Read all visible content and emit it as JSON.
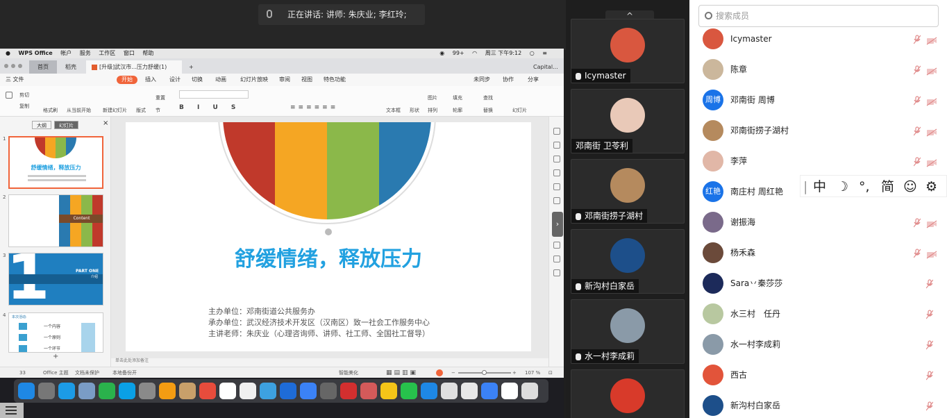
{
  "speaking": {
    "text": "正在讲话: 讲师: 朱庆业; 李红玲;"
  },
  "mac_menu": {
    "app": "WPS Office",
    "items": [
      "帐户",
      "服务",
      "工作区",
      "窗口",
      "帮助"
    ],
    "battery": "99+",
    "clock": "周三 下午9:12"
  },
  "tabs": [
    {
      "label": "首页"
    },
    {
      "label": "稻壳"
    },
    {
      "label": "[升级]武汉市...压力舒缓(1)"
    }
  ],
  "user_tag": "Capital...",
  "menu": {
    "file": "三 文件",
    "items": [
      "开始",
      "插入",
      "设计",
      "切换",
      "动画",
      "幻灯片放映",
      "审阅",
      "视图",
      "特色功能"
    ],
    "sync": "未同步",
    "collab": "协作",
    "share": "分享"
  },
  "ribbon": {
    "cut": "剪切",
    "copy": "复制",
    "paste": "粘贴",
    "format_painter": "格式刷",
    "play": "从当前开始",
    "new_slide": "新建幻灯片",
    "layout": "版式",
    "reset": "重置",
    "section": "节",
    "textbox": "文本框",
    "shapes": "形状",
    "image": "图片",
    "fill": "填充",
    "find": "查找",
    "arrange": "排列",
    "outline": "轮廓",
    "replace": "替换",
    "beautify": "演示工具",
    "slide_tool": "幻灯片"
  },
  "panel": {
    "tab_outline": "大纲",
    "tab_slides": "幻灯片",
    "close": "×",
    "add": "+"
  },
  "thumbs": [
    {
      "num": "1",
      "title": "舒缓情绪，释放压力"
    },
    {
      "num": "2",
      "label": "Content"
    },
    {
      "num": "3",
      "big": "1",
      "label": "PART ONE",
      "sub": "介绍"
    },
    {
      "num": "4",
      "header": "本次活动:",
      "rows": [
        "一个内容",
        "一个原则",
        "一个环节"
      ]
    }
  ],
  "slide": {
    "colors": [
      "#c0392b",
      "#f5a623",
      "#8bb84a",
      "#2a7ab0"
    ],
    "title": "舒缓情绪，释放压力",
    "lines": [
      "主办单位：邓南街道公共服务办",
      "承办单位：武汉经济技术开发区（汉南区）致一社会工作服务中心",
      "主讲老师：朱庆业（心理咨询师、讲师、社工师、全国社工督导）"
    ]
  },
  "notes_hint": "单击此处添加备注",
  "status": {
    "slide_of": "33",
    "theme": "Office 主题",
    "doc_protect": "文档未保护",
    "backup": "本地备份开",
    "beautify": "智能美化",
    "zoom": "107 %",
    "minus": "−",
    "plus": "+"
  },
  "dock_colors": [
    "#1e88e5",
    "#777",
    "#1c9be6",
    "#7a9cc6",
    "#2ab24c",
    "#0aa0e5",
    "#8a8a8a",
    "#f39c12",
    "#c8a06a",
    "#e74c3c",
    "#ffffff",
    "#f0f0f0",
    "#3da1e0",
    "#1e6cd8",
    "#3b82f6",
    "#666",
    "#d32f2f",
    "#d45a5a",
    "#f5c518",
    "#27c24c",
    "#1e88e5",
    "#e0e0e0",
    "#e8e8e8",
    "#3b82f6",
    "#ffffff",
    "#dddddd"
  ],
  "video_tiles": [
    {
      "name": "Icymaster",
      "color": "#d9573f",
      "muted": true
    },
    {
      "name": "邓南街 卫苓利",
      "color": "#e9c9b8",
      "muted": false
    },
    {
      "name": "邓南街捞子湖村",
      "color": "#b58a5e",
      "muted": true
    },
    {
      "name": "新沟村白家岳",
      "color": "#1d4f8a",
      "muted": true
    },
    {
      "name": "水一村李成莉",
      "color": "#8a9aa8",
      "muted": true
    },
    {
      "name": "",
      "color": "#d83a2a",
      "muted": false
    }
  ],
  "search": {
    "placeholder": "搜索成员"
  },
  "members": [
    {
      "name": "Icymaster",
      "color": "#d9573f",
      "initials": "",
      "cam": true
    },
    {
      "name": "陈章",
      "color": "#cbb79c",
      "initials": "",
      "cam": true
    },
    {
      "name": "邓南街 周博",
      "color": "#1a73e8",
      "initials": "周博",
      "cam": true
    },
    {
      "name": "邓南街捞子湖村",
      "color": "#b58a5e",
      "initials": "",
      "cam": true
    },
    {
      "name": "李萍",
      "color": "#e1b7a7",
      "initials": "",
      "cam": true
    },
    {
      "name": "南庄村 周红艳",
      "color": "#1a73e8",
      "initials": "红艳",
      "cam": false
    },
    {
      "name": "谢振海",
      "color": "#7a6a8a",
      "initials": "",
      "cam": true
    },
    {
      "name": "杨禾森",
      "color": "#6b4a3a",
      "initials": "",
      "cam": true
    },
    {
      "name": "Sara丷秦莎莎",
      "color": "#1c2a5a",
      "initials": "",
      "cam": false
    },
    {
      "name": "水三村　任丹",
      "color": "#b8c8a0",
      "initials": "",
      "cam": false
    },
    {
      "name": "水一村李成莉",
      "color": "#8a9aa8",
      "initials": "",
      "cam": false
    },
    {
      "name": "西古",
      "color": "#e2543a",
      "initials": "",
      "cam": false
    },
    {
      "name": "新沟村白家岳",
      "color": "#1d4f8a",
      "initials": "",
      "cam": false
    }
  ],
  "ime": {
    "sep": "|",
    "mode": "中",
    "moon": "☽",
    "punct": "°,",
    "simp": "简",
    "emoji": "☺",
    "gear": "⚙"
  },
  "collapse_icon": "^"
}
